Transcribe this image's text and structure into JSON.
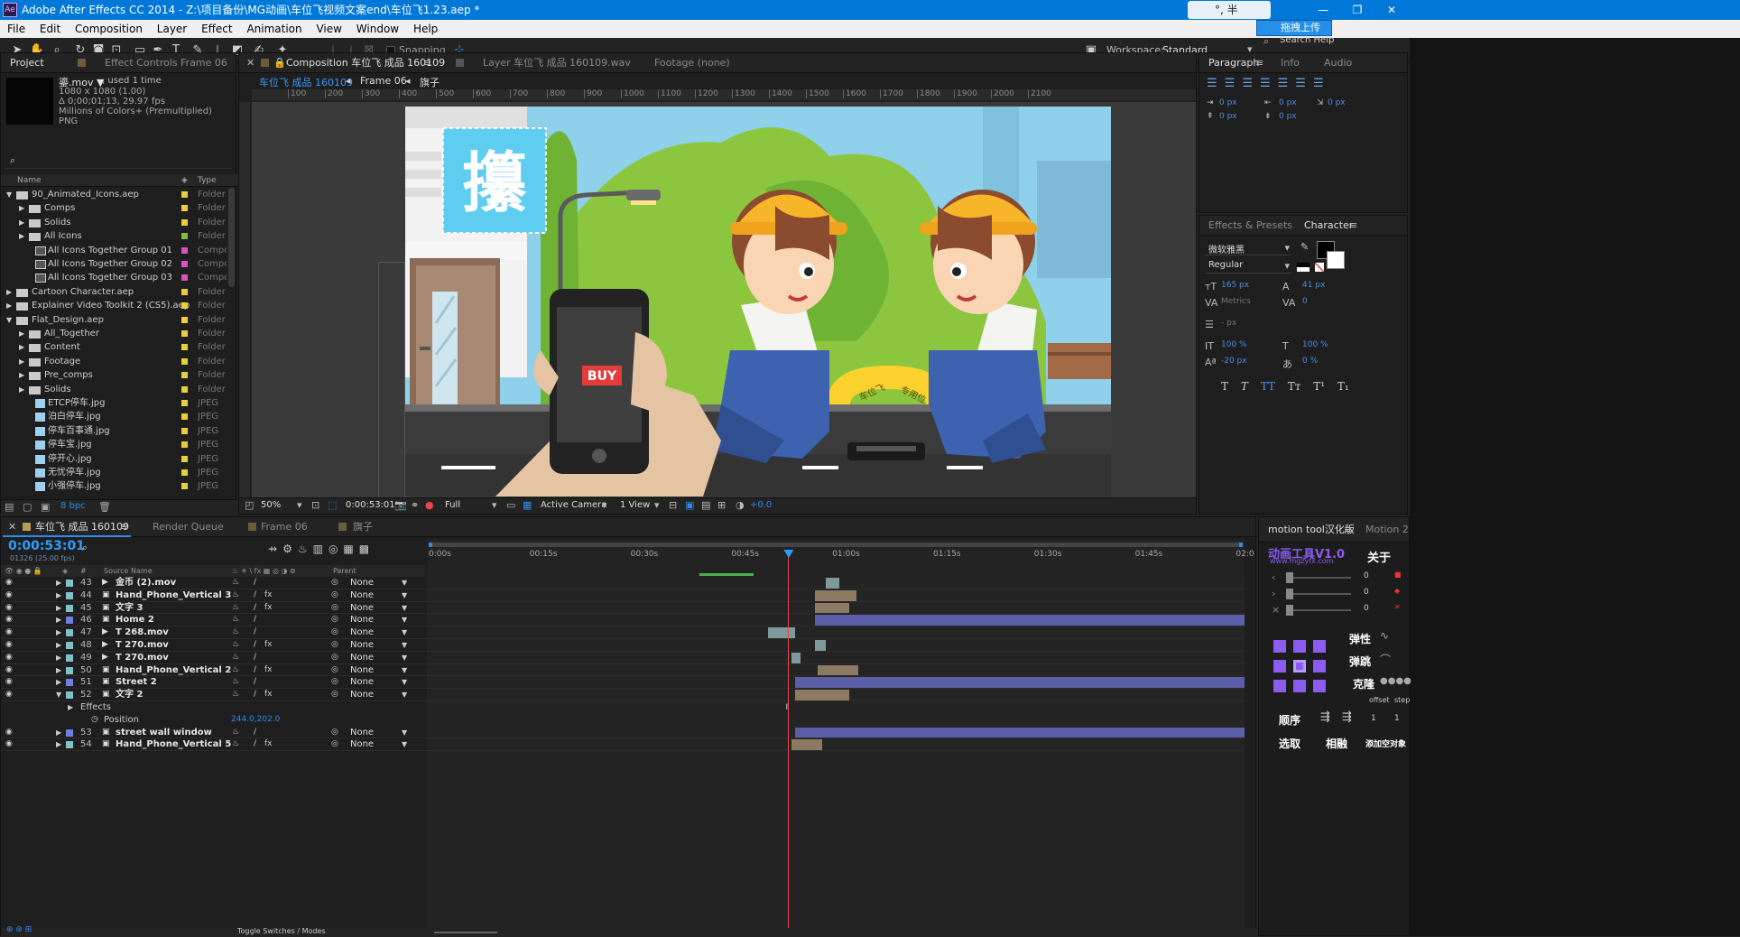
{
  "window": {
    "app_icon": "Ae",
    "title": "Adobe After Effects CC 2014 - Z:\\项目备份\\MG动画\\车位飞视频文案end\\车位飞1.23.aep *",
    "ime": "°, 半",
    "upload": "拖拽上传"
  },
  "menu": [
    "File",
    "Edit",
    "Composition",
    "Layer",
    "Effect",
    "Animation",
    "View",
    "Window",
    "Help"
  ],
  "toolbar": {
    "snapping": "Snapping",
    "workspace_label": "Workspace:",
    "workspace_value": "Standard",
    "search": "Search Help"
  },
  "project": {
    "tabs": [
      "Project",
      "Effect Controls Frame 06"
    ],
    "asset_name": "鎏.mov ▼",
    "asset_used": ", used 1 time",
    "asset_info": [
      "1080 x 1080 (1.00)",
      "Δ 0;00;01;13, 29.97 fps",
      "Millions of Colors+ (Premultiplied)",
      "PNG"
    ],
    "columns": {
      "name": "Name",
      "type": "Type"
    },
    "items": [
      {
        "name": "90_Animated_Icons.aep",
        "type": "Folder",
        "level": 0,
        "open": true,
        "kind": "folder",
        "color": "#e6cf3a"
      },
      {
        "name": "Comps",
        "type": "Folder",
        "level": 1,
        "open": false,
        "kind": "folder",
        "color": "#e6cf3a"
      },
      {
        "name": "Solids",
        "type": "Folder",
        "level": 1,
        "open": false,
        "kind": "folder",
        "color": "#e6cf3a"
      },
      {
        "name": "All Icons",
        "type": "Folder",
        "level": 1,
        "open": false,
        "kind": "folder",
        "color": "#7fbf3f"
      },
      {
        "name": "All Icons Together Group 01",
        "type": "Compo",
        "level": 1,
        "kind": "comp",
        "color": "#d653b8"
      },
      {
        "name": "All Icons Together Group 02",
        "type": "Compo",
        "level": 1,
        "kind": "comp",
        "color": "#d653b8"
      },
      {
        "name": "All Icons Together Group 03",
        "type": "Compo",
        "level": 1,
        "kind": "comp",
        "color": "#d653b8"
      },
      {
        "name": "Cartoon Character.aep",
        "type": "Folder",
        "level": 0,
        "open": false,
        "kind": "folder",
        "color": "#e6cf3a"
      },
      {
        "name": "Explainer Video Toolkit 2 (CS5).aep",
        "type": "Folder",
        "level": 0,
        "open": false,
        "kind": "folder",
        "color": "#e6cf3a"
      },
      {
        "name": "Flat_Design.aep",
        "type": "Folder",
        "level": 0,
        "open": true,
        "kind": "folder",
        "color": "#e6cf3a"
      },
      {
        "name": "All_Together",
        "type": "Folder",
        "level": 1,
        "open": false,
        "kind": "folder",
        "color": "#e6cf3a"
      },
      {
        "name": "Content",
        "type": "Folder",
        "level": 1,
        "open": false,
        "kind": "folder",
        "color": "#e6cf3a"
      },
      {
        "name": "Footage",
        "type": "Folder",
        "level": 1,
        "open": false,
        "kind": "folder",
        "color": "#e6cf3a"
      },
      {
        "name": "Pre_comps",
        "type": "Folder",
        "level": 1,
        "open": false,
        "kind": "folder",
        "color": "#e6cf3a"
      },
      {
        "name": "Solids",
        "type": "Folder",
        "level": 1,
        "open": false,
        "kind": "folder",
        "color": "#e6cf3a"
      },
      {
        "name": "ETCP停车.jpg",
        "type": "JPEG",
        "level": 1,
        "kind": "file",
        "color": "#e6cf3a"
      },
      {
        "name": "泊白停车.jpg",
        "type": "JPEG",
        "level": 1,
        "kind": "file",
        "color": "#e6cf3a"
      },
      {
        "name": "停车百事通.jpg",
        "type": "JPEG",
        "level": 1,
        "kind": "file",
        "color": "#e6cf3a"
      },
      {
        "name": "停车宝.jpg",
        "type": "JPEG",
        "level": 1,
        "kind": "file",
        "color": "#e6cf3a"
      },
      {
        "name": "停开心.jpg",
        "type": "JPEG",
        "level": 1,
        "kind": "file",
        "color": "#e6cf3a"
      },
      {
        "name": "无忧停车.jpg",
        "type": "JPEG",
        "level": 1,
        "kind": "file",
        "color": "#e6cf3a"
      },
      {
        "name": "小强停车.jpg",
        "type": "JPEG",
        "level": 1,
        "kind": "file",
        "color": "#e6cf3a"
      }
    ],
    "bpc": "8 bpc"
  },
  "composition": {
    "tabs": [
      "Composition 车位飞 成品 160109",
      "Layer 车位飞 成品 160109.wav",
      "Footage (none)"
    ],
    "breadcrumbs": [
      "车位飞 成品 160109",
      "Frame 06",
      "旗子"
    ],
    "ruler_ticks": [
      "100",
      "200",
      "300",
      "400",
      "500",
      "600",
      "700",
      "800",
      "900",
      "1000",
      "1100",
      "1200",
      "1300",
      "1400",
      "1500",
      "1600",
      "1700",
      "1800",
      "1900",
      "2000",
      "2100"
    ],
    "sign_char": "攥",
    "phone_label": "BUY",
    "lock_text": [
      "车位飞",
      "专用位"
    ],
    "footer": {
      "zoom": "50%",
      "timecode": "0:00:53:01",
      "resolution": "Full",
      "camera": "Active Camera",
      "views": "1 View",
      "exposure": "+0.0"
    }
  },
  "paragraph": {
    "tabs": [
      "Paragraph",
      "Info",
      "Audio"
    ],
    "fields": [
      "0 px",
      "0 px",
      "0 px",
      "0 px",
      "0 px"
    ]
  },
  "character": {
    "tabs": [
      "Effects & Presets",
      "Character"
    ],
    "font": "微软雅黑",
    "style": "Regular",
    "size": "165 px",
    "leading": "41 px",
    "kerning": "Metrics",
    "tracking": "0",
    "stroke": "- px",
    "vscale": "100 %",
    "hscale": "100 %",
    "baseline": "-20 px",
    "tsume": "0 %",
    "styles": [
      "T",
      "T",
      "TT",
      "Tт",
      "T¹",
      "T₁"
    ]
  },
  "timeline": {
    "tabs": [
      "车位飞 成品 160109",
      "Render Queue",
      "Frame 06",
      "旗子"
    ],
    "timecode": "0:00:53:01",
    "frame_info": "01326 (25.00 fps)",
    "col_source": "Source Name",
    "col_parent": "Parent",
    "col_num": "#",
    "ticks": [
      "0:00s",
      "00:15s",
      "00:30s",
      "00:45s",
      "01:00s",
      "01:15s",
      "01:30s",
      "01:45s",
      "02:0"
    ],
    "playhead_s": 53.04,
    "duration_s": 120,
    "layers": [
      {
        "num": "43",
        "name": "金币 (2).mov",
        "parent": "None",
        "color": "#7fc1c6",
        "kind": "mov",
        "fx": false,
        "bar": [
          58.5,
          60.5
        ],
        "bar_color": "#7e9a9c"
      },
      {
        "num": "44",
        "name": "Hand_Phone_Vertical 3",
        "parent": "None",
        "color": "#7fc1c6",
        "kind": "comp",
        "fx": true,
        "bar": [
          57,
          63
        ],
        "bar_color": "#8c7a63"
      },
      {
        "num": "45",
        "name": "文字 3",
        "parent": "None",
        "color": "#7fc1c6",
        "kind": "comp",
        "fx": true,
        "bar": [
          57,
          62
        ],
        "bar_color": "#8c7a63"
      },
      {
        "num": "46",
        "name": "Home 2",
        "parent": "None",
        "color": "#6f7fe0",
        "kind": "comp",
        "fx": false,
        "bar": [
          57,
          120
        ],
        "bar_color": "#5a5fa8"
      },
      {
        "num": "47",
        "name": "T 268.mov",
        "parent": "None",
        "color": "#7fc1c6",
        "kind": "mov",
        "fx": false,
        "bar": [
          50,
          54
        ],
        "bar_color": "#7e9a9c"
      },
      {
        "num": "48",
        "name": "T 270.mov",
        "parent": "None",
        "color": "#7fc1c6",
        "kind": "mov",
        "fx": true,
        "bar": [
          57,
          58.5
        ],
        "bar_color": "#7e9a9c"
      },
      {
        "num": "49",
        "name": "T 270.mov",
        "parent": "None",
        "color": "#7fc1c6",
        "kind": "mov",
        "fx": false,
        "bar": [
          53.5,
          54.8
        ],
        "bar_color": "#7e9a9c"
      },
      {
        "num": "50",
        "name": "Hand_Phone_Vertical 2",
        "parent": "None",
        "color": "#7fc1c6",
        "kind": "comp",
        "fx": true,
        "bar": [
          57.3,
          63.3
        ],
        "bar_color": "#8c7a63"
      },
      {
        "num": "51",
        "name": "Street 2",
        "parent": "None",
        "color": "#6f7fe0",
        "kind": "comp",
        "fx": false,
        "bar": [
          54,
          120
        ],
        "bar_color": "#5a5fa8"
      },
      {
        "num": "52",
        "name": "文字 2",
        "parent": "None",
        "color": "#7fc1c6",
        "kind": "comp",
        "fx": true,
        "bar": [
          54,
          62
        ],
        "bar_color": "#8c7a63",
        "open": true
      },
      {
        "num": "53",
        "name": "street wall window",
        "parent": "None",
        "color": "#6f7fe0",
        "kind": "comp",
        "fx": false,
        "bar": [
          54,
          120
        ],
        "bar_color": "#5a5fa8"
      },
      {
        "num": "54",
        "name": "Hand_Phone_Vertical 5",
        "parent": "None",
        "color": "#7fc1c6",
        "kind": "comp",
        "fx": true,
        "bar": [
          53.5,
          58
        ],
        "bar_color": "#8c7a63"
      }
    ],
    "effects_label": "Effects",
    "position_label": "Position",
    "position_value": "244.0,202.0",
    "toggle": "Toggle Switches / Modes"
  },
  "motion": {
    "tabs": [
      "motion tool汉化版",
      "Motion 2"
    ],
    "logo": "动画工具V1.0",
    "url": "www.mgzyfx.com",
    "about": "关于",
    "values": [
      "0",
      "0",
      "0"
    ],
    "labels": {
      "elastic": "弹性",
      "bounce": "弹跳",
      "clone": "克隆",
      "offset": "offset",
      "step": "step",
      "order": "顺序",
      "select": "选取",
      "opposite": "相融",
      "add_null": "添加空对象"
    },
    "order_vals": [
      "1",
      "1"
    ]
  }
}
